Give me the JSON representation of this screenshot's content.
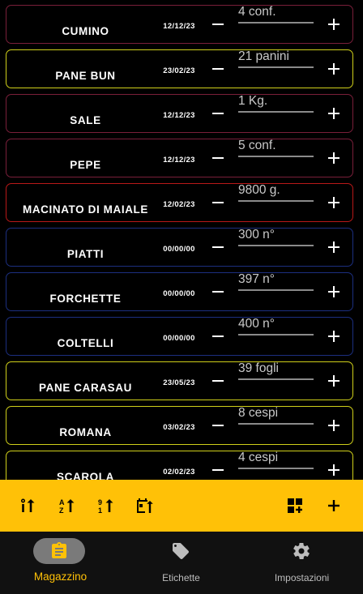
{
  "items": [
    {
      "name": "CUMINO",
      "date": "12/12/23",
      "qty": "4 conf.",
      "border": "#7a1f3a"
    },
    {
      "name": "PANE BUN",
      "date": "23/02/23",
      "qty": "21 panini",
      "border": "#cfcf1a"
    },
    {
      "name": "SALE",
      "date": "12/12/23",
      "qty": "1 Kg.",
      "border": "#7a1f3a"
    },
    {
      "name": "PEPE",
      "date": "12/12/23",
      "qty": "5 conf.",
      "border": "#7a1f3a"
    },
    {
      "name": "MACINATO DI MAIALE",
      "date": "12/02/23",
      "qty": "9800 g.",
      "border": "#b81818"
    },
    {
      "name": "PIATTI",
      "date": "00/00/00",
      "qty": "300 n°",
      "border": "#1c2f80"
    },
    {
      "name": "FORCHETTE",
      "date": "00/00/00",
      "qty": "397 n°",
      "border": "#1c2f80"
    },
    {
      "name": "COLTELLI",
      "date": "00/00/00",
      "qty": "400 n°",
      "border": "#1c2f80"
    },
    {
      "name": "PANE CARASAU",
      "date": "23/05/23",
      "qty": "39 fogli",
      "border": "#cfcf1a"
    },
    {
      "name": "ROMANA",
      "date": "03/02/23",
      "qty": "8 cespi",
      "border": "#cfcf1a"
    },
    {
      "name": "SCAROLA",
      "date": "02/02/23",
      "qty": "4 cespi",
      "border": "#cfcf1a"
    }
  ],
  "toolbar": {
    "color": "#ffc107",
    "icons": [
      "sort-icon",
      "sort-alpha-icon",
      "sort-numeric-icon",
      "sort-date-icon",
      "add-category-icon",
      "add-icon"
    ]
  },
  "nav": [
    {
      "label": "Magazzino",
      "icon": "clipboard-icon",
      "active": true
    },
    {
      "label": "Etichette",
      "icon": "tag-icon",
      "active": false
    },
    {
      "label": "Impostazioni",
      "icon": "gear-icon",
      "active": false
    }
  ]
}
